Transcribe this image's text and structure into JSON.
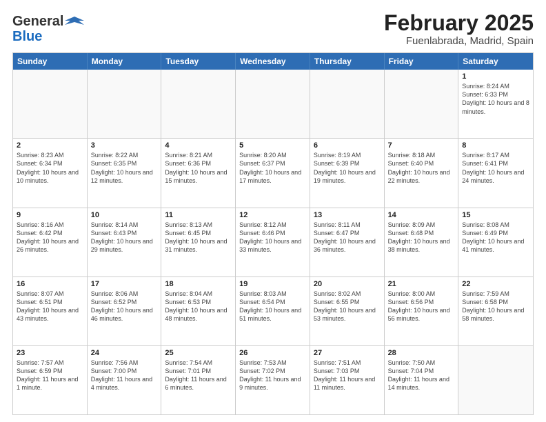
{
  "logo": {
    "general": "General",
    "blue": "Blue"
  },
  "title": "February 2025",
  "location": "Fuenlabrada, Madrid, Spain",
  "days_of_week": [
    "Sunday",
    "Monday",
    "Tuesday",
    "Wednesday",
    "Thursday",
    "Friday",
    "Saturday"
  ],
  "weeks": [
    [
      {
        "day": "",
        "info": ""
      },
      {
        "day": "",
        "info": ""
      },
      {
        "day": "",
        "info": ""
      },
      {
        "day": "",
        "info": ""
      },
      {
        "day": "",
        "info": ""
      },
      {
        "day": "",
        "info": ""
      },
      {
        "day": "1",
        "info": "Sunrise: 8:24 AM\nSunset: 6:33 PM\nDaylight: 10 hours and 8 minutes."
      }
    ],
    [
      {
        "day": "2",
        "info": "Sunrise: 8:23 AM\nSunset: 6:34 PM\nDaylight: 10 hours and 10 minutes."
      },
      {
        "day": "3",
        "info": "Sunrise: 8:22 AM\nSunset: 6:35 PM\nDaylight: 10 hours and 12 minutes."
      },
      {
        "day": "4",
        "info": "Sunrise: 8:21 AM\nSunset: 6:36 PM\nDaylight: 10 hours and 15 minutes."
      },
      {
        "day": "5",
        "info": "Sunrise: 8:20 AM\nSunset: 6:37 PM\nDaylight: 10 hours and 17 minutes."
      },
      {
        "day": "6",
        "info": "Sunrise: 8:19 AM\nSunset: 6:39 PM\nDaylight: 10 hours and 19 minutes."
      },
      {
        "day": "7",
        "info": "Sunrise: 8:18 AM\nSunset: 6:40 PM\nDaylight: 10 hours and 22 minutes."
      },
      {
        "day": "8",
        "info": "Sunrise: 8:17 AM\nSunset: 6:41 PM\nDaylight: 10 hours and 24 minutes."
      }
    ],
    [
      {
        "day": "9",
        "info": "Sunrise: 8:16 AM\nSunset: 6:42 PM\nDaylight: 10 hours and 26 minutes."
      },
      {
        "day": "10",
        "info": "Sunrise: 8:14 AM\nSunset: 6:43 PM\nDaylight: 10 hours and 29 minutes."
      },
      {
        "day": "11",
        "info": "Sunrise: 8:13 AM\nSunset: 6:45 PM\nDaylight: 10 hours and 31 minutes."
      },
      {
        "day": "12",
        "info": "Sunrise: 8:12 AM\nSunset: 6:46 PM\nDaylight: 10 hours and 33 minutes."
      },
      {
        "day": "13",
        "info": "Sunrise: 8:11 AM\nSunset: 6:47 PM\nDaylight: 10 hours and 36 minutes."
      },
      {
        "day": "14",
        "info": "Sunrise: 8:09 AM\nSunset: 6:48 PM\nDaylight: 10 hours and 38 minutes."
      },
      {
        "day": "15",
        "info": "Sunrise: 8:08 AM\nSunset: 6:49 PM\nDaylight: 10 hours and 41 minutes."
      }
    ],
    [
      {
        "day": "16",
        "info": "Sunrise: 8:07 AM\nSunset: 6:51 PM\nDaylight: 10 hours and 43 minutes."
      },
      {
        "day": "17",
        "info": "Sunrise: 8:06 AM\nSunset: 6:52 PM\nDaylight: 10 hours and 46 minutes."
      },
      {
        "day": "18",
        "info": "Sunrise: 8:04 AM\nSunset: 6:53 PM\nDaylight: 10 hours and 48 minutes."
      },
      {
        "day": "19",
        "info": "Sunrise: 8:03 AM\nSunset: 6:54 PM\nDaylight: 10 hours and 51 minutes."
      },
      {
        "day": "20",
        "info": "Sunrise: 8:02 AM\nSunset: 6:55 PM\nDaylight: 10 hours and 53 minutes."
      },
      {
        "day": "21",
        "info": "Sunrise: 8:00 AM\nSunset: 6:56 PM\nDaylight: 10 hours and 56 minutes."
      },
      {
        "day": "22",
        "info": "Sunrise: 7:59 AM\nSunset: 6:58 PM\nDaylight: 10 hours and 58 minutes."
      }
    ],
    [
      {
        "day": "23",
        "info": "Sunrise: 7:57 AM\nSunset: 6:59 PM\nDaylight: 11 hours and 1 minute."
      },
      {
        "day": "24",
        "info": "Sunrise: 7:56 AM\nSunset: 7:00 PM\nDaylight: 11 hours and 4 minutes."
      },
      {
        "day": "25",
        "info": "Sunrise: 7:54 AM\nSunset: 7:01 PM\nDaylight: 11 hours and 6 minutes."
      },
      {
        "day": "26",
        "info": "Sunrise: 7:53 AM\nSunset: 7:02 PM\nDaylight: 11 hours and 9 minutes."
      },
      {
        "day": "27",
        "info": "Sunrise: 7:51 AM\nSunset: 7:03 PM\nDaylight: 11 hours and 11 minutes."
      },
      {
        "day": "28",
        "info": "Sunrise: 7:50 AM\nSunset: 7:04 PM\nDaylight: 11 hours and 14 minutes."
      },
      {
        "day": "",
        "info": ""
      }
    ]
  ]
}
